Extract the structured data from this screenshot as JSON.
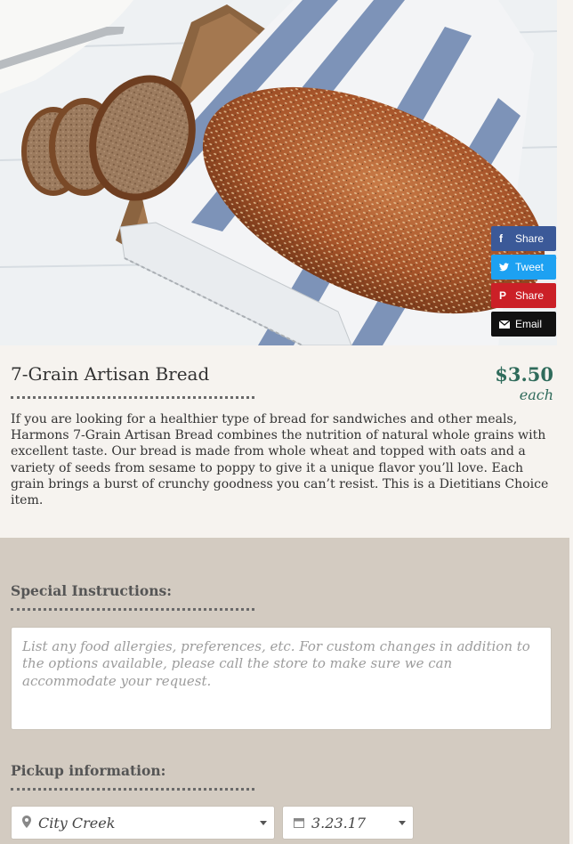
{
  "product": {
    "title": "7-Grain Artisan Bread",
    "price": "$3.50",
    "unit": "each",
    "description": "If you are looking for a healthier type of bread for sandwiches and other meals, Harmons 7-Grain Artisan Bread combines the nutrition of natural whole grains with excellent taste. Our bread is made from whole wheat and topped with oats and a variety of seeds from sesame to poppy to give it a unique flavor you’ll love. Each grain brings a burst of crunchy goodness you can’t resist. This is a Dietitians Choice item."
  },
  "share": {
    "facebook": "Share",
    "twitter": "Tweet",
    "pinterest": "Share",
    "email": "Email"
  },
  "order": {
    "instructions_label": "Special Instructions:",
    "instructions_placeholder": "List any food allergies, preferences, etc. For custom changes in addition to the options available, please call the store to make sure we can accommodate your request.",
    "pickup_label": "Pickup information:",
    "store": "City Creek",
    "date": "3.23.17"
  },
  "colors": {
    "accent": "#2f6b5b",
    "panel": "#d3cbc1",
    "background": "#f6f3ef"
  },
  "icons": [
    "facebook-icon",
    "twitter-icon",
    "pinterest-icon",
    "email-icon",
    "location-pin-icon",
    "calendar-icon",
    "chevron-down-icon"
  ]
}
